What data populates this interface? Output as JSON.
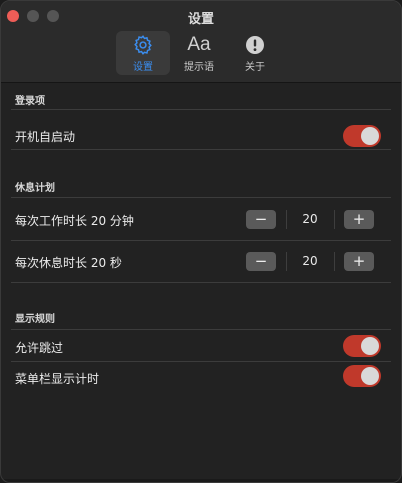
{
  "window": {
    "title": "设置"
  },
  "tabs": [
    {
      "label": "设置",
      "icon": "gear-icon",
      "active": true
    },
    {
      "label": "提示语",
      "icon": "text-aa-icon",
      "glyph": "Aa",
      "active": false
    },
    {
      "label": "关于",
      "icon": "info-icon",
      "active": false
    }
  ],
  "sections": {
    "login": {
      "header": "登录项",
      "launch_at_login": {
        "label": "开机自启动",
        "on": true
      }
    },
    "break_plan": {
      "header": "休息计划",
      "work_duration": {
        "label": "每次工作时长 20 分钟",
        "value": "20",
        "minus": "−",
        "plus": "+"
      },
      "rest_duration": {
        "label": "每次休息时长 20 秒",
        "value": "20",
        "minus": "−",
        "plus": "+"
      }
    },
    "display_rules": {
      "header": "显示规则",
      "allow_skip": {
        "label": "允许跳过",
        "on": true
      },
      "menubar_timer": {
        "label": "菜单栏显示计时",
        "on": true
      }
    }
  },
  "colors": {
    "accent": "#3b8ef0",
    "toggle_on": "#c0392b",
    "close": "#ee5d57"
  }
}
